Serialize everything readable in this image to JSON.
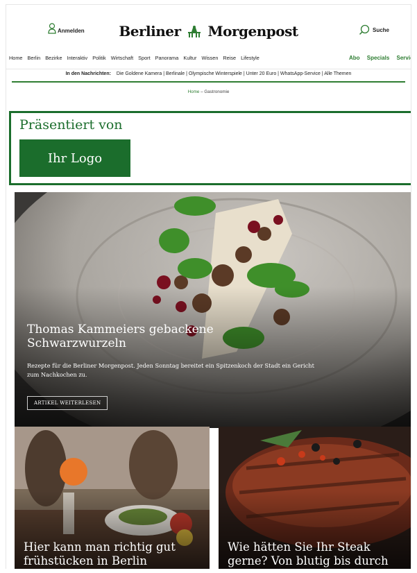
{
  "header": {
    "login_label": "Anmelden",
    "brand_left": "Berliner",
    "brand_right": "Morgenpost",
    "search_label": "Suche"
  },
  "nav": {
    "items": [
      "Home",
      "Berlin",
      "Bezirke",
      "Interaktiv",
      "Politik",
      "Wirtschaft",
      "Sport",
      "Panorama",
      "Kultur",
      "Wissen",
      "Reise",
      "Lifestyle"
    ],
    "right_items": [
      "Abo",
      "Specials",
      "Service"
    ]
  },
  "news_bar": {
    "label": "In den Nachrichten:",
    "topics": "Die Goldene Kamera | Berlinale | Olympische Winterspiele | Unter 20 Euro | WhatsApp-Service | Alle Themen"
  },
  "breadcrumb": {
    "home": "Home",
    "separator": " – ",
    "current": "Gastronomie"
  },
  "sponsor": {
    "label": "Präsentiert von",
    "logo_label": "Ihr Logo"
  },
  "hero": {
    "title": "Thomas Kammeiers gebackene Schwarzwurzeln",
    "description": "Rezepte für die Berliner Morgenpost. Jeden Sonntag bereitet ein Spitzenkoch der Stadt ein Gericht zum Nachkochen zu.",
    "button_label": "ARTIKEL WEITERLESEN"
  },
  "cards": [
    {
      "title": "Hier kann man richtig gut frühstücken in Berlin"
    },
    {
      "title": "Wie hätten Sie Ihr Steak gerne? Von blutig bis durch"
    }
  ],
  "colors": {
    "brand_green": "#2e7d32",
    "sponsor_green": "#1b6d2c"
  }
}
